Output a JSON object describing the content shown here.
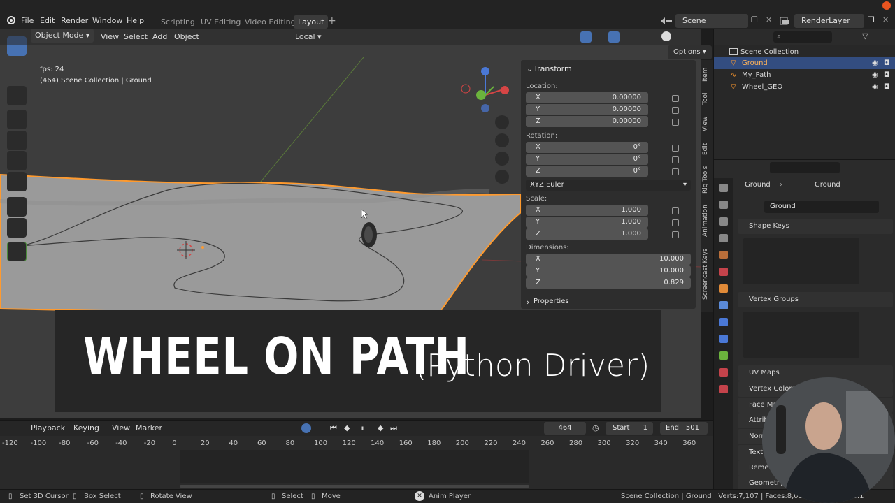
{
  "menu": {
    "file": "File",
    "edit": "Edit",
    "render": "Render",
    "window": "Window",
    "help": "Help"
  },
  "workspaces": [
    "Scripting",
    "UV Editing",
    "Video Editing",
    "Layout"
  ],
  "scene": {
    "name": "Scene",
    "render_layer": "RenderLayer"
  },
  "viewport": {
    "mode": "Object Mode",
    "menus": [
      "View",
      "Select",
      "Add",
      "Object"
    ],
    "orientation": "Local",
    "options": "Options",
    "fps": "fps: 24",
    "info": "(464) Scene Collection | Ground"
  },
  "transform": {
    "title": "Transform",
    "location_label": "Location:",
    "location": [
      {
        "axis": "X",
        "value": "0.00000"
      },
      {
        "axis": "Y",
        "value": "0.00000"
      },
      {
        "axis": "Z",
        "value": "0.00000"
      }
    ],
    "rotation_label": "Rotation:",
    "rotation": [
      {
        "axis": "X",
        "value": "0°"
      },
      {
        "axis": "Y",
        "value": "0°"
      },
      {
        "axis": "Z",
        "value": "0°"
      }
    ],
    "rotation_mode": "XYZ Euler",
    "scale_label": "Scale:",
    "scale": [
      {
        "axis": "X",
        "value": "1.000"
      },
      {
        "axis": "Y",
        "value": "1.000"
      },
      {
        "axis": "Z",
        "value": "1.000"
      }
    ],
    "dimensions_label": "Dimensions:",
    "dimensions": [
      {
        "axis": "X",
        "value": "10.000"
      },
      {
        "axis": "Y",
        "value": "10.000"
      },
      {
        "axis": "Z",
        "value": "0.829"
      }
    ],
    "properties": "Properties"
  },
  "side_tabs": [
    "Item",
    "Tool",
    "View",
    "Edit",
    "Rig Tools",
    "Animation",
    "Screencast Keys"
  ],
  "outliner": {
    "root": "Scene Collection",
    "items": [
      "Ground",
      "My_Path",
      "Wheel_GEO"
    ]
  },
  "properties": {
    "breadcrumb": [
      "Ground",
      "Ground"
    ],
    "mesh_name": "Ground",
    "sections": [
      "Shape Keys",
      "Vertex Groups",
      "UV Maps",
      "Vertex Colors",
      "Face Maps",
      "Attributes",
      "Normals",
      "Texture Space",
      "Remesh",
      "Geometry Data"
    ]
  },
  "timeline": {
    "menus": [
      "Playback",
      "Keying",
      "View",
      "Marker"
    ],
    "current_frame": "464",
    "start_label": "Start",
    "start": "1",
    "end_label": "End",
    "end": "501",
    "ticks": [
      "-120",
      "-100",
      "-80",
      "-60",
      "-40",
      "-20",
      "0",
      "20",
      "40",
      "60",
      "80",
      "100",
      "120",
      "140",
      "160",
      "180",
      "200",
      "220",
      "240",
      "260",
      "280",
      "300",
      "320",
      "340",
      "360"
    ]
  },
  "status": {
    "set_cursor": "Set 3D Cursor",
    "box_select": "Box Select",
    "rotate_view": "Rotate View",
    "select": "Select",
    "move": "Move",
    "anim_player": "Anim Player",
    "info": "Scene Collection | Ground | Verts:7,107 | Faces:8,085 | Tris:1/3 | 3.0.1"
  },
  "banner": {
    "title": "WHEEL ON PATH",
    "subtitle": "(Python Driver)"
  },
  "colors": {
    "accent": "#4772b3",
    "selection": "#ff9a2e",
    "background": "#3d3d3d"
  }
}
